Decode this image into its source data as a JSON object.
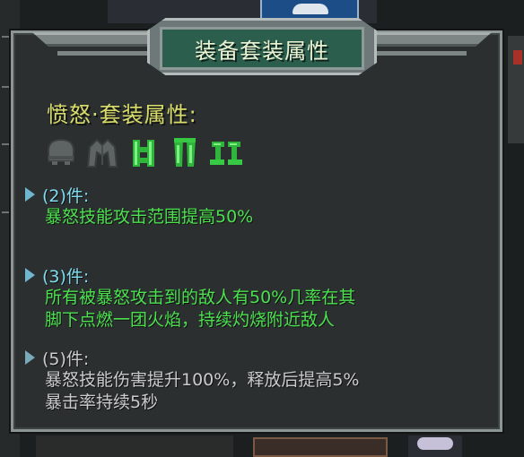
{
  "panel": {
    "title": "装备套装属性",
    "set_name": "愤怒·套装属性:"
  },
  "armor_pieces": [
    {
      "icon": "helmet-icon",
      "equipped": false
    },
    {
      "icon": "chestplate-icon",
      "equipped": false
    },
    {
      "icon": "vest-icon",
      "equipped": true
    },
    {
      "icon": "leggings-icon",
      "equipped": true
    },
    {
      "icon": "boots-icon",
      "equipped": true
    }
  ],
  "tiers": [
    {
      "label": "(2)件:",
      "description": [
        "暴怒技能攻击范围提高50%"
      ],
      "active": true
    },
    {
      "label": "(3)件:",
      "description": [
        "所有被暴怒攻击到的敌人有50%几率在其",
        "脚下点燃一团火焰，持续灼烧附近敌人"
      ],
      "active": true
    },
    {
      "label": "(5)件:",
      "description": [
        "暴怒技能伤害提升100%，释放后提高5%",
        "暴击率持续5秒"
      ],
      "active": false
    }
  ],
  "colors": {
    "active_text": "#4be14f",
    "inactive_text": "#c9cccc",
    "set_name": "#d8dd6a",
    "title_bg": "#2c5e4e",
    "arrow": "#6fb6ce"
  }
}
